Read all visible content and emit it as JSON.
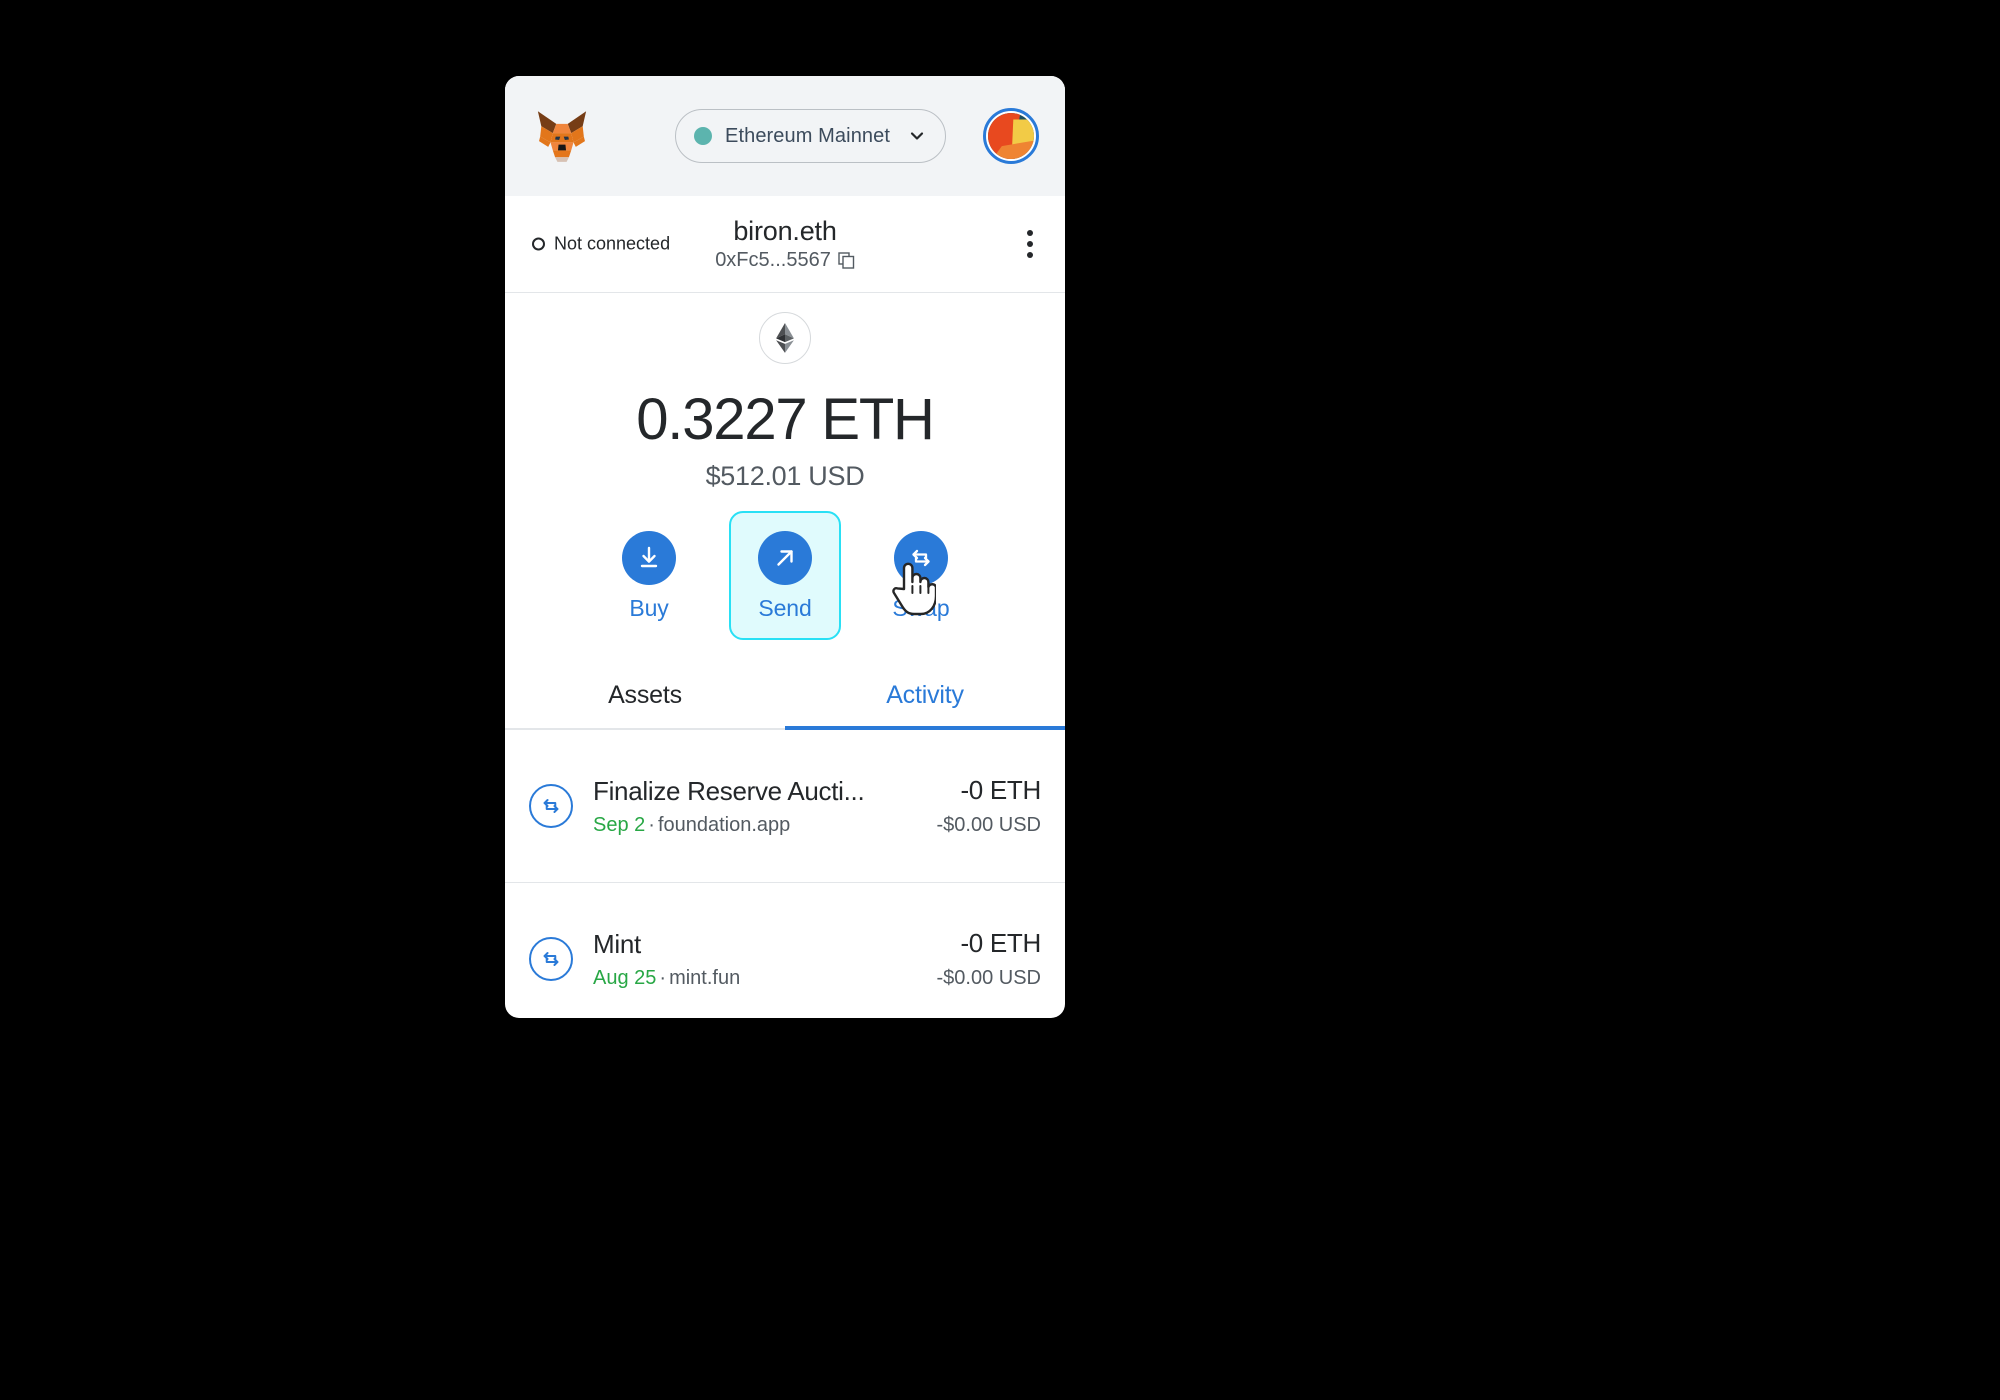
{
  "header": {
    "logo_name": "metamask-fox-logo",
    "network": {
      "label": "Ethereum Mainnet",
      "dot_color": "#5cb4ae",
      "chevron_icon": "chevron-down-icon"
    },
    "avatar_name": "account-avatar-jazzicon"
  },
  "account": {
    "connection_status": "Not connected",
    "name": "biron.eth",
    "address": "0xFc5...5567",
    "copy_icon": "copy-icon",
    "menu_icon": "kebab-menu-icon"
  },
  "balance": {
    "token_icon": "ethereum-icon",
    "primary": "0.3227 ETH",
    "secondary": "$512.01 USD"
  },
  "actions": [
    {
      "label": "Buy",
      "icon": "download-arrow-icon",
      "focused": false
    },
    {
      "label": "Send",
      "icon": "arrow-up-right-icon",
      "focused": true
    },
    {
      "label": "Swap",
      "icon": "swap-arrows-icon",
      "focused": false
    }
  ],
  "tabs": [
    {
      "label": "Assets",
      "active": false
    },
    {
      "label": "Activity",
      "active": true
    }
  ],
  "transactions": [
    {
      "icon": "swap-arrows-icon",
      "title": "Finalize Reserve Aucti...",
      "date": "Sep 2",
      "separator": "·",
      "origin": "foundation.app",
      "amount": "-0 ETH",
      "fiat": "-$0.00 USD"
    },
    {
      "icon": "swap-arrows-icon",
      "title": "Mint",
      "date": "Aug 25",
      "separator": "·",
      "origin": "mint.fun",
      "amount": "-0 ETH",
      "fiat": "-$0.00 USD"
    }
  ],
  "colors": {
    "accent_blue": "#2a7ad8",
    "focus_cyan": "#29e0f5",
    "focus_fill": "#e0fbfd",
    "date_green": "#28a745",
    "header_bg": "#f2f4f6"
  }
}
